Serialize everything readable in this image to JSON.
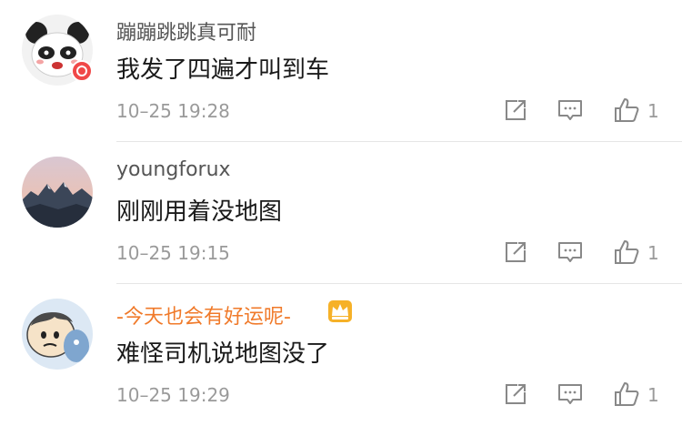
{
  "comments": [
    {
      "username": "蹦蹦跳跳真可耐",
      "content": "我发了四遍才叫到车",
      "time": "10–25 19:28",
      "likes": "1",
      "avatar": "panda-avatar",
      "username_color": "#555555"
    },
    {
      "username": "youngforux",
      "content": "刚刚用着没地图",
      "time": "10–25 19:15",
      "likes": "1",
      "avatar": "mountain-avatar",
      "username_color": "#555555"
    },
    {
      "username": "-今天也会有好运呢-",
      "content": "难怪司机说地图没了",
      "time": "10–25 19:29",
      "likes": "1",
      "avatar": "cartoon-avatar",
      "username_color": "#f07a2a"
    }
  ],
  "icons": {
    "share": "share-icon",
    "reply": "comment-icon",
    "like": "thumbs-up-icon",
    "vip": "crown-icon",
    "verified": "verified-badge-icon"
  }
}
